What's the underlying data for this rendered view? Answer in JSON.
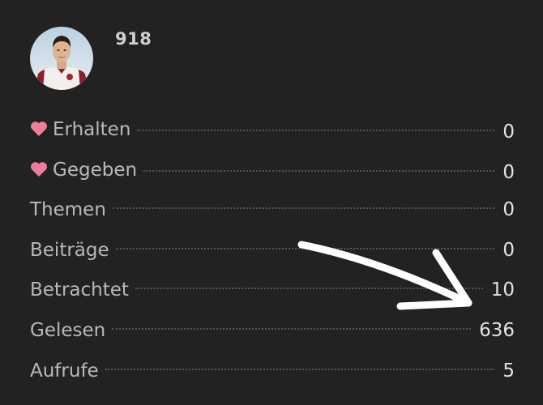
{
  "user": {
    "username": "918",
    "avatar_icon": "user-avatar-photo"
  },
  "stats": [
    {
      "label": "Erhalten",
      "value": "0",
      "icon": "heart-icon"
    },
    {
      "label": "Gegeben",
      "value": "0",
      "icon": "heart-icon"
    },
    {
      "label": "Themen",
      "value": "0"
    },
    {
      "label": "Beiträge",
      "value": "0"
    },
    {
      "label": "Betrachtet",
      "value": "10"
    },
    {
      "label": "Gelesen",
      "value": "636"
    },
    {
      "label": "Aufrufe",
      "value": "5"
    }
  ],
  "colors": {
    "background": "#222222",
    "heart": "#f07c9c",
    "label": "#b9b9b9",
    "value": "#e2e2e2",
    "annotation_arrow": "#ffffff"
  }
}
